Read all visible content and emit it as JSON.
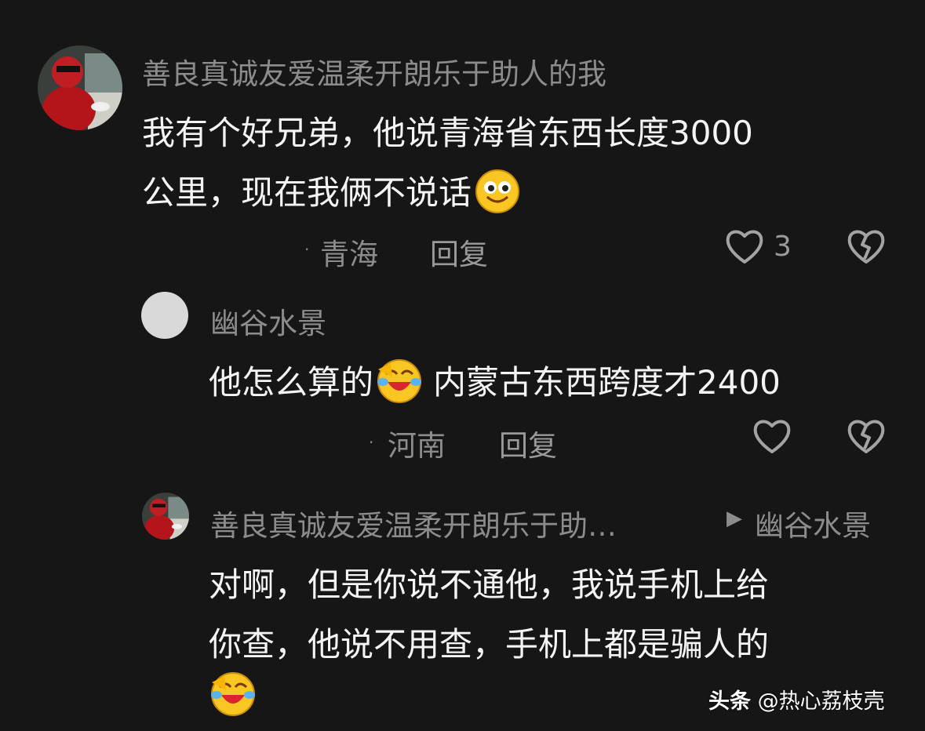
{
  "comment_main": {
    "username": "善良真诚友爱温柔开朗乐于助人的我",
    "line1": "我有个好兄弟，他说青海省东西长度3000",
    "line2": "公里，现在我俩不说话",
    "location": "青海",
    "reply_label": "回复",
    "like_count": "3",
    "emoji": "smiling-face-emoji"
  },
  "reply_1": {
    "username": "幽谷水景",
    "text_before_emoji": "他怎么算的",
    "text_after_emoji": "内蒙古东西跨度才2400",
    "location": "河南",
    "reply_label": "回复",
    "emoji": "crying-laughing-emoji"
  },
  "reply_2": {
    "username": "善良真诚友爱温柔开朗乐于助…",
    "reply_to_marker": "▶",
    "reply_to": "幽谷水景",
    "line1": "对啊，但是你说不通他，我说手机上给",
    "line2": "你查，他说不用查，手机上都是骗人的",
    "emoji": "crying-laughing-emoji"
  },
  "watermark": {
    "brand": "头条",
    "handle": "@热心荔枝壳"
  },
  "colors": {
    "background": "#161616",
    "primary_text": "#f4f4f4",
    "secondary_text": "#8c8c8c"
  }
}
